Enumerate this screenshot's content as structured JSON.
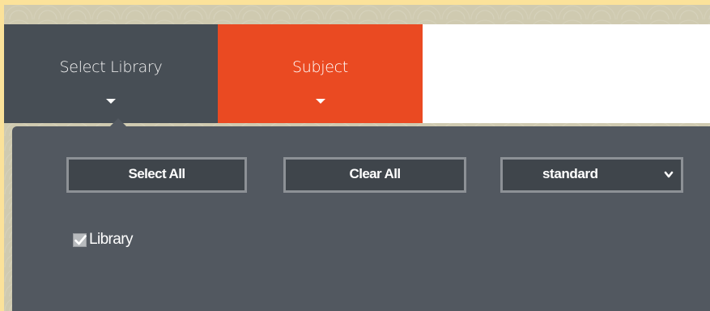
{
  "tabs": [
    {
      "label": "Select Library",
      "active": true
    },
    {
      "label": "Subject",
      "active": false
    }
  ],
  "panel": {
    "select_all_label": "Select All",
    "clear_all_label": "Clear All",
    "dropdown": {
      "selected": "standard",
      "icon": "chevron-down-icon"
    },
    "checkboxes": [
      {
        "label": "Library",
        "checked": true
      }
    ]
  },
  "colors": {
    "tab_library_bg": "#474e55",
    "tab_subject_bg": "#ea4a22",
    "panel_bg": "#525860",
    "button_bg": "#3f454b",
    "button_border": "#8d9196",
    "outer_border": "#fbe29a"
  }
}
